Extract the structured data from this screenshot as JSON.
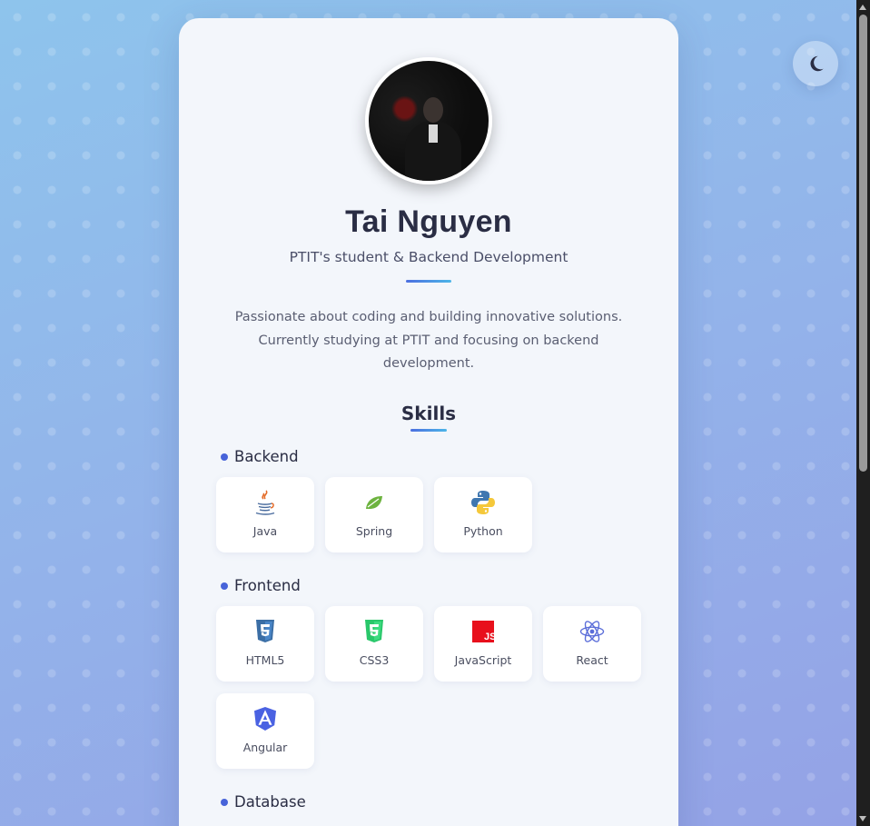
{
  "profile": {
    "name": "Tai Nguyen",
    "subtitle": "PTIT's student & Backend Development",
    "bio": "Passionate about coding and building innovative solutions. Currently studying at PTIT and focusing on backend development."
  },
  "skills": {
    "title": "Skills",
    "categories": [
      {
        "name": "Backend",
        "items": [
          {
            "label": "Java",
            "icon": "java-icon"
          },
          {
            "label": "Spring",
            "icon": "spring-leaf-icon"
          },
          {
            "label": "Python",
            "icon": "python-icon"
          }
        ]
      },
      {
        "name": "Frontend",
        "items": [
          {
            "label": "HTML5",
            "icon": "html5-icon"
          },
          {
            "label": "CSS3",
            "icon": "css3-icon"
          },
          {
            "label": "JavaScript",
            "icon": "javascript-icon"
          },
          {
            "label": "React",
            "icon": "react-icon"
          },
          {
            "label": "Angular",
            "icon": "angular-icon"
          }
        ]
      },
      {
        "name": "Database",
        "items": []
      }
    ]
  },
  "theme_toggle": {
    "icon": "moon-icon"
  },
  "colors": {
    "accent": "#4763d9",
    "card_bg": "#f3f6fb",
    "text_dark": "#2a2d44"
  }
}
